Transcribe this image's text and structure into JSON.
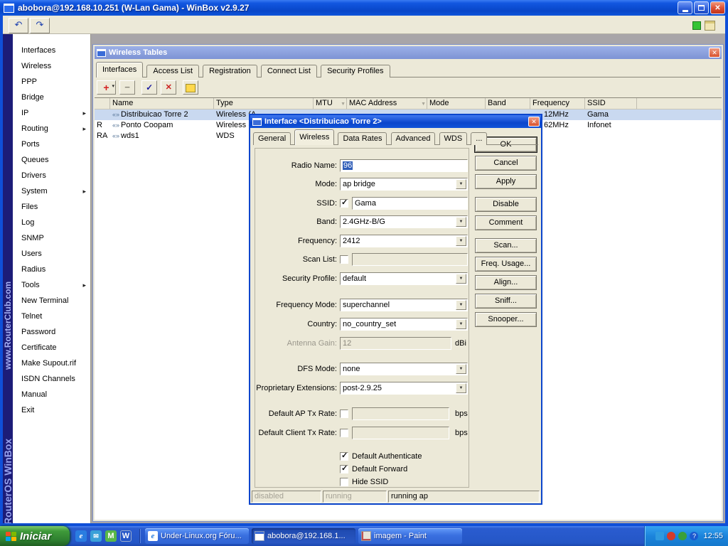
{
  "app": {
    "title": "abobora@192.168.10.251 (W-Lan Gama) - WinBox v2.9.27"
  },
  "branding": {
    "product": "RouterOS WinBox",
    "site": "www.RouterClub.com"
  },
  "sidebar": {
    "items": [
      {
        "label": "Interfaces",
        "submenu": false
      },
      {
        "label": "Wireless",
        "submenu": false
      },
      {
        "label": "PPP",
        "submenu": false
      },
      {
        "label": "Bridge",
        "submenu": false
      },
      {
        "label": "IP",
        "submenu": true
      },
      {
        "label": "Routing",
        "submenu": true
      },
      {
        "label": "Ports",
        "submenu": false
      },
      {
        "label": "Queues",
        "submenu": false
      },
      {
        "label": "Drivers",
        "submenu": false
      },
      {
        "label": "System",
        "submenu": true
      },
      {
        "label": "Files",
        "submenu": false
      },
      {
        "label": "Log",
        "submenu": false
      },
      {
        "label": "SNMP",
        "submenu": false
      },
      {
        "label": "Users",
        "submenu": false
      },
      {
        "label": "Radius",
        "submenu": false
      },
      {
        "label": "Tools",
        "submenu": true
      },
      {
        "label": "New Terminal",
        "submenu": false
      },
      {
        "label": "Telnet",
        "submenu": false
      },
      {
        "label": "Password",
        "submenu": false
      },
      {
        "label": "Certificate",
        "submenu": false
      },
      {
        "label": "Make Supout.rif",
        "submenu": false
      },
      {
        "label": "ISDN Channels",
        "submenu": false
      },
      {
        "label": "Manual",
        "submenu": false
      },
      {
        "label": "Exit",
        "submenu": false
      }
    ]
  },
  "wireless_tables": {
    "title": "Wireless Tables",
    "tabs": [
      "Interfaces",
      "Access List",
      "Registration",
      "Connect List",
      "Security Profiles"
    ],
    "columns": [
      "Name",
      "Type",
      "MTU",
      "MAC Address",
      "Mode",
      "Band",
      "Frequency",
      "SSID"
    ],
    "rows": [
      {
        "flag": "",
        "name": "Distribuicao Torre 2",
        "type": "Wireless (A",
        "mtu": "",
        "mac": "",
        "mode": "",
        "band": "",
        "frequency": "12MHz",
        "ssid": "Gama"
      },
      {
        "flag": "R",
        "name": "Ponto Coopam",
        "type": "Wireless (A",
        "mtu": "",
        "mac": "",
        "mode": "",
        "band": "",
        "frequency": "62MHz",
        "ssid": "Infonet"
      },
      {
        "flag": "RA",
        "name": "wds1",
        "type": "WDS",
        "mtu": "",
        "mac": "",
        "mode": "",
        "band": "",
        "frequency": "",
        "ssid": ""
      }
    ]
  },
  "dialog": {
    "title": "Interface <Distribuicao Torre 2>",
    "tabs": [
      "General",
      "Wireless",
      "Data Rates",
      "Advanced",
      "WDS",
      "..."
    ],
    "fields": {
      "radio_name": {
        "label": "Radio Name:",
        "value": "96"
      },
      "mode": {
        "label": "Mode:",
        "value": "ap bridge"
      },
      "ssid": {
        "label": "SSID:",
        "value": "Gama",
        "checked": true
      },
      "band": {
        "label": "Band:",
        "value": "2.4GHz-B/G"
      },
      "frequency": {
        "label": "Frequency:",
        "value": "2412"
      },
      "scan_list": {
        "label": "Scan List:",
        "value": "",
        "checked": false
      },
      "security_profile": {
        "label": "Security Profile:",
        "value": "default"
      },
      "frequency_mode": {
        "label": "Frequency Mode:",
        "value": "superchannel"
      },
      "country": {
        "label": "Country:",
        "value": "no_country_set"
      },
      "antenna_gain": {
        "label": "Antenna Gain:",
        "value": "12",
        "unit": "dBi"
      },
      "dfs_mode": {
        "label": "DFS Mode:",
        "value": "none"
      },
      "proprietary_extensions": {
        "label": "Proprietary Extensions:",
        "value": "post-2.9.25"
      },
      "default_ap_tx_rate": {
        "label": "Default AP Tx Rate:",
        "value": "",
        "unit": "bps",
        "checked": false
      },
      "default_client_tx_rate": {
        "label": "Default Client Tx Rate:",
        "value": "",
        "unit": "bps",
        "checked": false
      },
      "default_authenticate": {
        "label": "Default Authenticate",
        "checked": true
      },
      "default_forward": {
        "label": "Default Forward",
        "checked": true
      },
      "hide_ssid": {
        "label": "Hide SSID",
        "checked": false
      }
    },
    "buttons": [
      "OK",
      "Cancel",
      "Apply",
      "Disable",
      "Comment",
      "Scan...",
      "Freq. Usage...",
      "Align...",
      "Sniff...",
      "Snooper..."
    ],
    "status": [
      "disabled",
      "running",
      "running ap"
    ]
  },
  "taskbar": {
    "start_label": "Iniciar",
    "windows": [
      {
        "label": "Under-Linux.org Fóru...",
        "active": false
      },
      {
        "label": "abobora@192.168.1...",
        "active": true
      },
      {
        "label": "imagem - Paint",
        "active": false
      }
    ],
    "clock": "12:55"
  }
}
